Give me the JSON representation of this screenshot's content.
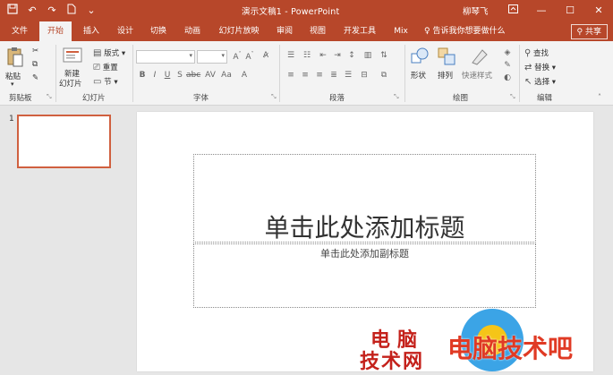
{
  "window": {
    "title": "演示文稿1  -  PowerPoint",
    "user": "柳琴飞",
    "accent": "#b7472a"
  },
  "qat": {
    "icons": [
      "save-icon",
      "undo-icon",
      "redo-icon",
      "new-doc-icon",
      "customize-icon"
    ]
  },
  "tabs": [
    {
      "label": "文件"
    },
    {
      "label": "开始"
    },
    {
      "label": "插入"
    },
    {
      "label": "设计"
    },
    {
      "label": "切换"
    },
    {
      "label": "动画"
    },
    {
      "label": "幻灯片放映"
    },
    {
      "label": "审阅"
    },
    {
      "label": "视图"
    },
    {
      "label": "开发工具"
    },
    {
      "label": "Mix"
    }
  ],
  "active_tab": "开始",
  "tell_me": "告诉我你想要做什么",
  "share": "共享",
  "ribbon": {
    "clipboard": {
      "label": "剪贴板",
      "paste": "粘贴"
    },
    "slides": {
      "label": "幻灯片",
      "new_slide_1": "新建",
      "new_slide_2": "幻灯片",
      "layout": "版式",
      "reset": "重置",
      "section": "节"
    },
    "font": {
      "label": "字体"
    },
    "paragraph": {
      "label": "段落"
    },
    "drawing": {
      "label": "绘图",
      "shapes": "形状",
      "arrange": "排列",
      "quick_styles": "快速样式"
    },
    "editing": {
      "label": "编辑",
      "find": "查找",
      "replace": "替换",
      "select": "选择"
    }
  },
  "thumbnails": [
    {
      "number": "1"
    }
  ],
  "slide": {
    "title_placeholder": "单击此处添加标题",
    "subtitle_placeholder": "单击此处添加副标题"
  },
  "watermark": {
    "left_line1": "电脑",
    "left_line2": "技术网",
    "right_text": "电脑技术吧"
  }
}
